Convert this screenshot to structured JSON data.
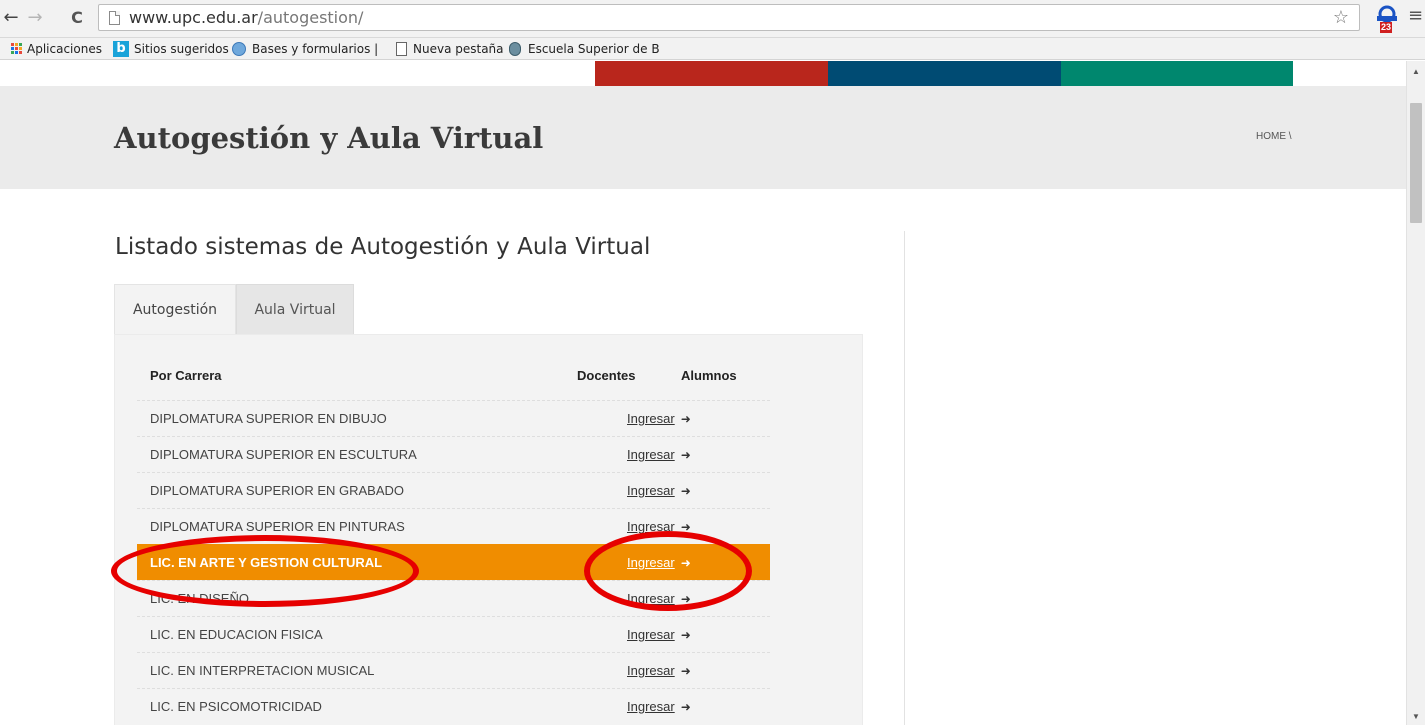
{
  "browser": {
    "url_host": "www.upc.edu.ar",
    "url_path": "/autogestion/",
    "extension_badge": "23",
    "bookmarks": [
      {
        "label": "Aplicaciones"
      },
      {
        "label": "Sitios sugeridos"
      },
      {
        "label": "Bases y formularios |"
      },
      {
        "label": "Nueva pestaña"
      },
      {
        "label": "Escuela Superior de B"
      }
    ]
  },
  "hero": {
    "title": "Autogestión y Aula Virtual",
    "breadcrumb": "HOME \\"
  },
  "main": {
    "section_title": "Listado sistemas de Autogestión y Aula Virtual",
    "tabs": [
      {
        "label": "Autogestión",
        "active": true
      },
      {
        "label": "Aula Virtual",
        "active": false
      }
    ],
    "table": {
      "headers": [
        "Por Carrera",
        "Docentes",
        "Alumnos"
      ],
      "link_label": "Ingresar",
      "rows": [
        {
          "carrera": "DIPLOMATURA SUPERIOR EN DIBUJO",
          "link": "Ingresar",
          "highlighted": false
        },
        {
          "carrera": "DIPLOMATURA SUPERIOR EN ESCULTURA",
          "link": "Ingresar",
          "highlighted": false
        },
        {
          "carrera": "DIPLOMATURA SUPERIOR EN GRABADO",
          "link": "Ingresar",
          "highlighted": false
        },
        {
          "carrera": "DIPLOMATURA SUPERIOR EN PINTURAS",
          "link": "Ingresar",
          "highlighted": false
        },
        {
          "carrera": "LIC. EN ARTE Y GESTION CULTURAL",
          "link": "Ingresar",
          "highlighted": true
        },
        {
          "carrera": "LIC. EN DISEÑO",
          "link": "Ingresar",
          "highlighted": false
        },
        {
          "carrera": "LIC. EN EDUCACION FISICA",
          "link": "Ingresar",
          "highlighted": false
        },
        {
          "carrera": "LIC. EN INTERPRETACION MUSICAL",
          "link": "Ingresar",
          "highlighted": false
        },
        {
          "carrera": "LIC. EN PSICOMOTRICIDAD",
          "link": "Ingresar",
          "highlighted": false
        }
      ]
    }
  },
  "colors": {
    "highlight": "#f08d00",
    "annotation": "#e60000",
    "bar_red": "#b9261c",
    "bar_blue": "#004b73",
    "bar_green": "#00876e"
  }
}
